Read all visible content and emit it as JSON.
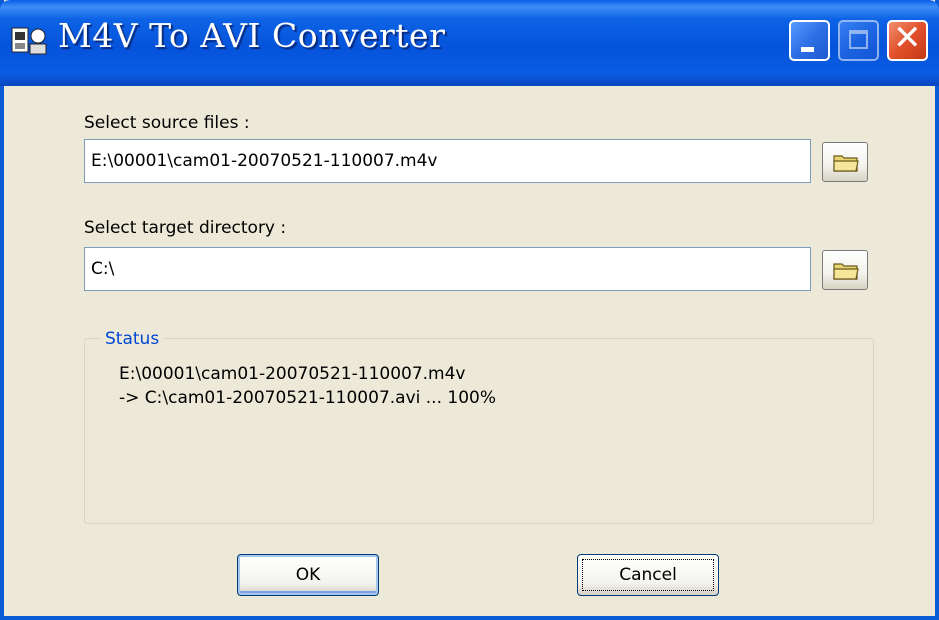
{
  "window": {
    "title": "M4V To AVI Converter",
    "title_bar_color": "#0A5CE4"
  },
  "titlebar": {
    "minimize_icon": "minimize-icon",
    "maximize_icon": "maximize-icon",
    "close_icon": "close-icon",
    "close_glyph": "✕"
  },
  "source": {
    "label": "Select source files :",
    "value": "E:\\00001\\cam01-20070521-110007.m4v",
    "browse_icon": "folder-icon"
  },
  "target": {
    "label": "Select target directory :",
    "value": "C:\\",
    "browse_icon": "folder-icon"
  },
  "status": {
    "legend": "Status",
    "lines": [
      "E:\\00001\\cam01-20070521-110007.m4v",
      "-> C:\\cam01-20070521-110007.avi ... 100%"
    ]
  },
  "buttons": {
    "ok_label": "OK",
    "cancel_label": "Cancel"
  }
}
